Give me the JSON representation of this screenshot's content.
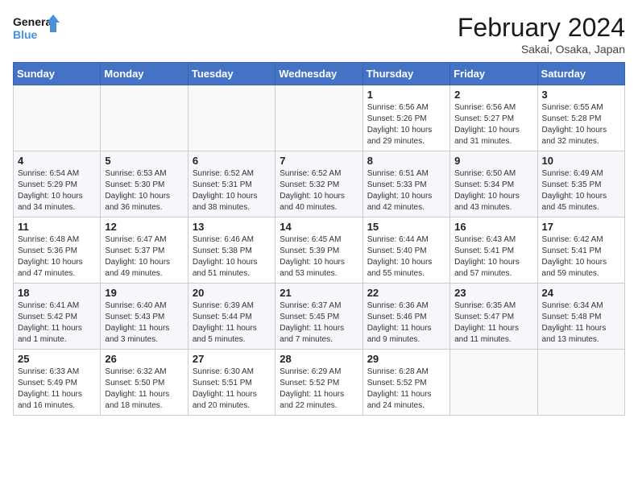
{
  "logo": {
    "line1": "General",
    "line2": "Blue"
  },
  "title": "February 2024",
  "subtitle": "Sakai, Osaka, Japan",
  "weekdays": [
    "Sunday",
    "Monday",
    "Tuesday",
    "Wednesday",
    "Thursday",
    "Friday",
    "Saturday"
  ],
  "weeks": [
    [
      {
        "day": "",
        "info": ""
      },
      {
        "day": "",
        "info": ""
      },
      {
        "day": "",
        "info": ""
      },
      {
        "day": "",
        "info": ""
      },
      {
        "day": "1",
        "info": "Sunrise: 6:56 AM\nSunset: 5:26 PM\nDaylight: 10 hours\nand 29 minutes."
      },
      {
        "day": "2",
        "info": "Sunrise: 6:56 AM\nSunset: 5:27 PM\nDaylight: 10 hours\nand 31 minutes."
      },
      {
        "day": "3",
        "info": "Sunrise: 6:55 AM\nSunset: 5:28 PM\nDaylight: 10 hours\nand 32 minutes."
      }
    ],
    [
      {
        "day": "4",
        "info": "Sunrise: 6:54 AM\nSunset: 5:29 PM\nDaylight: 10 hours\nand 34 minutes."
      },
      {
        "day": "5",
        "info": "Sunrise: 6:53 AM\nSunset: 5:30 PM\nDaylight: 10 hours\nand 36 minutes."
      },
      {
        "day": "6",
        "info": "Sunrise: 6:52 AM\nSunset: 5:31 PM\nDaylight: 10 hours\nand 38 minutes."
      },
      {
        "day": "7",
        "info": "Sunrise: 6:52 AM\nSunset: 5:32 PM\nDaylight: 10 hours\nand 40 minutes."
      },
      {
        "day": "8",
        "info": "Sunrise: 6:51 AM\nSunset: 5:33 PM\nDaylight: 10 hours\nand 42 minutes."
      },
      {
        "day": "9",
        "info": "Sunrise: 6:50 AM\nSunset: 5:34 PM\nDaylight: 10 hours\nand 43 minutes."
      },
      {
        "day": "10",
        "info": "Sunrise: 6:49 AM\nSunset: 5:35 PM\nDaylight: 10 hours\nand 45 minutes."
      }
    ],
    [
      {
        "day": "11",
        "info": "Sunrise: 6:48 AM\nSunset: 5:36 PM\nDaylight: 10 hours\nand 47 minutes."
      },
      {
        "day": "12",
        "info": "Sunrise: 6:47 AM\nSunset: 5:37 PM\nDaylight: 10 hours\nand 49 minutes."
      },
      {
        "day": "13",
        "info": "Sunrise: 6:46 AM\nSunset: 5:38 PM\nDaylight: 10 hours\nand 51 minutes."
      },
      {
        "day": "14",
        "info": "Sunrise: 6:45 AM\nSunset: 5:39 PM\nDaylight: 10 hours\nand 53 minutes."
      },
      {
        "day": "15",
        "info": "Sunrise: 6:44 AM\nSunset: 5:40 PM\nDaylight: 10 hours\nand 55 minutes."
      },
      {
        "day": "16",
        "info": "Sunrise: 6:43 AM\nSunset: 5:41 PM\nDaylight: 10 hours\nand 57 minutes."
      },
      {
        "day": "17",
        "info": "Sunrise: 6:42 AM\nSunset: 5:41 PM\nDaylight: 10 hours\nand 59 minutes."
      }
    ],
    [
      {
        "day": "18",
        "info": "Sunrise: 6:41 AM\nSunset: 5:42 PM\nDaylight: 11 hours\nand 1 minute."
      },
      {
        "day": "19",
        "info": "Sunrise: 6:40 AM\nSunset: 5:43 PM\nDaylight: 11 hours\nand 3 minutes."
      },
      {
        "day": "20",
        "info": "Sunrise: 6:39 AM\nSunset: 5:44 PM\nDaylight: 11 hours\nand 5 minutes."
      },
      {
        "day": "21",
        "info": "Sunrise: 6:37 AM\nSunset: 5:45 PM\nDaylight: 11 hours\nand 7 minutes."
      },
      {
        "day": "22",
        "info": "Sunrise: 6:36 AM\nSunset: 5:46 PM\nDaylight: 11 hours\nand 9 minutes."
      },
      {
        "day": "23",
        "info": "Sunrise: 6:35 AM\nSunset: 5:47 PM\nDaylight: 11 hours\nand 11 minutes."
      },
      {
        "day": "24",
        "info": "Sunrise: 6:34 AM\nSunset: 5:48 PM\nDaylight: 11 hours\nand 13 minutes."
      }
    ],
    [
      {
        "day": "25",
        "info": "Sunrise: 6:33 AM\nSunset: 5:49 PM\nDaylight: 11 hours\nand 16 minutes."
      },
      {
        "day": "26",
        "info": "Sunrise: 6:32 AM\nSunset: 5:50 PM\nDaylight: 11 hours\nand 18 minutes."
      },
      {
        "day": "27",
        "info": "Sunrise: 6:30 AM\nSunset: 5:51 PM\nDaylight: 11 hours\nand 20 minutes."
      },
      {
        "day": "28",
        "info": "Sunrise: 6:29 AM\nSunset: 5:52 PM\nDaylight: 11 hours\nand 22 minutes."
      },
      {
        "day": "29",
        "info": "Sunrise: 6:28 AM\nSunset: 5:52 PM\nDaylight: 11 hours\nand 24 minutes."
      },
      {
        "day": "",
        "info": ""
      },
      {
        "day": "",
        "info": ""
      }
    ]
  ]
}
